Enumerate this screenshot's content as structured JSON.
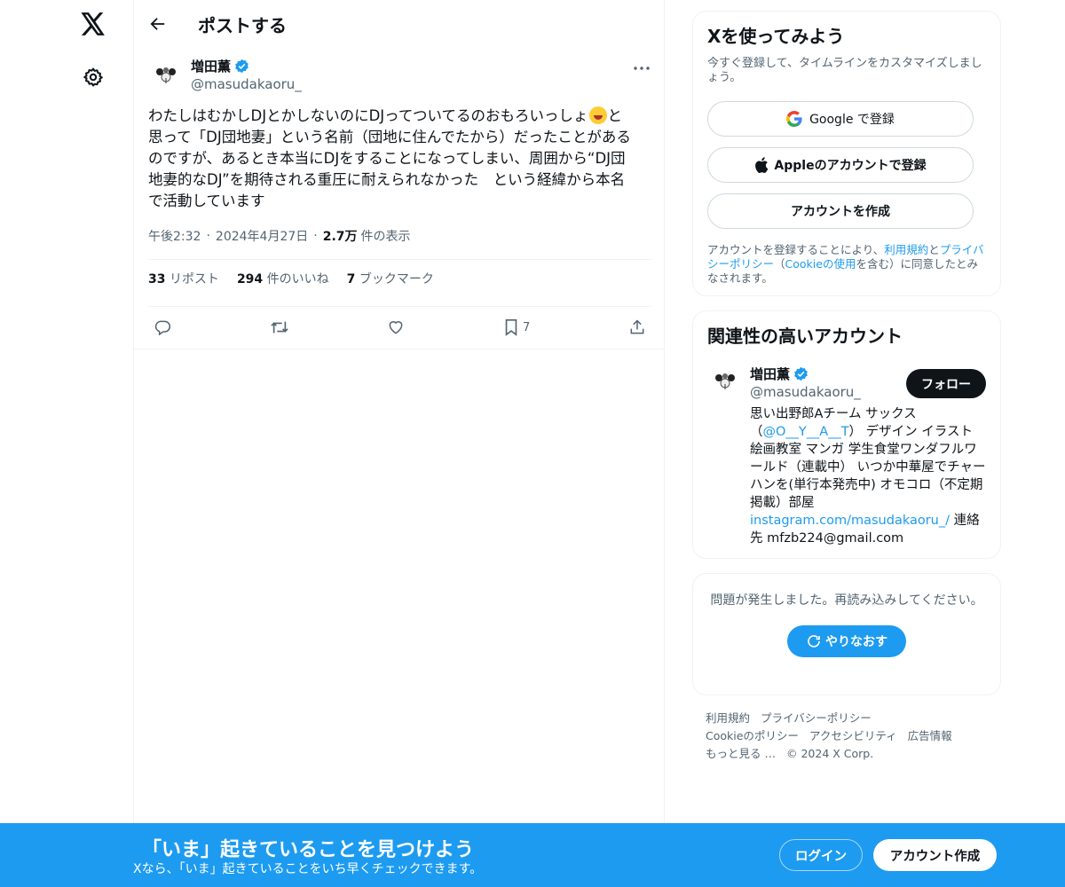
{
  "header": {
    "title": "ポストする"
  },
  "tweet": {
    "author_name": "増田薫",
    "author_handle": "@masudakaoru_",
    "text_part1": "わたしはむかしDJとかしないのにDJってついてるのおもろいっしょ",
    "text_part2": "と\n思って「DJ団地妻」という名前（団地に住んでたから）だったことがある\nのですが、あるとき本当にDJをすることになってしまい、周囲から“DJ団\n地妻的なDJ”を期待される重圧に耐えられなかった　という経緯から本名\nで活動しています",
    "time": "午後2:32",
    "date": "2024年4月27日",
    "views_count": "2.7万",
    "views_label": "件の表示",
    "reposts_count": "33",
    "reposts_label": "リポスト",
    "likes_count": "294",
    "likes_label": "件のいいね",
    "bookmarks_count": "7",
    "bookmarks_label": "ブックマーク",
    "bookmark_action_count": "7"
  },
  "signup": {
    "title": "Xを使ってみよう",
    "subtitle": "今すぐ登録して、タイムラインをカスタマイズしましょう。",
    "google_label": "Google で登録",
    "apple_label": "Appleのアカウントで登録",
    "create_label": "アカウントを作成",
    "terms_prefix": "アカウントを登録することにより、",
    "terms_link": "利用規約",
    "terms_and": "と",
    "privacy_link": "プライバシーポリシー",
    "terms_mid": "（",
    "cookie_link": "Cookieの使用",
    "terms_suffix": "を含む）に同意したとみなされます。"
  },
  "related": {
    "title": "関連性の高いアカウント",
    "name": "増田薫",
    "handle": "@masudakaoru_",
    "follow_label": "フォロー",
    "bio_part1": "思い出野郎Aチーム サックス（",
    "bio_mention": "@O__Y__A__T",
    "bio_part2": "） デザイン イラスト 絵画教室 マンガ 学生食堂ワンダフルワールド（連載中） いつか中華屋でチャーハンを(単行本発売中) オモコロ（不定期掲載）部屋 ",
    "bio_link": "instagram.com/masudakaoru_/",
    "bio_part3": " 連絡先 mfzb224@gmail.com"
  },
  "error": {
    "message": "問題が発生しました。再読み込みしてください。",
    "retry_label": "やりなおす"
  },
  "footer": {
    "links": [
      "利用規約",
      "プライバシーポリシー",
      "Cookieのポリシー",
      "アクセシビリティ",
      "広告情報",
      "もっと見る …",
      "© 2024 X Corp."
    ]
  },
  "bottom_bar": {
    "title": "「いま」起きていることを見つけよう",
    "subtitle": "Xなら、「いま」起きていることをいち早くチェックできます。",
    "login_label": "ログイン",
    "create_label": "アカウント作成"
  },
  "colors": {
    "accent": "#1d9bf0",
    "text": "#0f1419",
    "muted": "#536471"
  }
}
